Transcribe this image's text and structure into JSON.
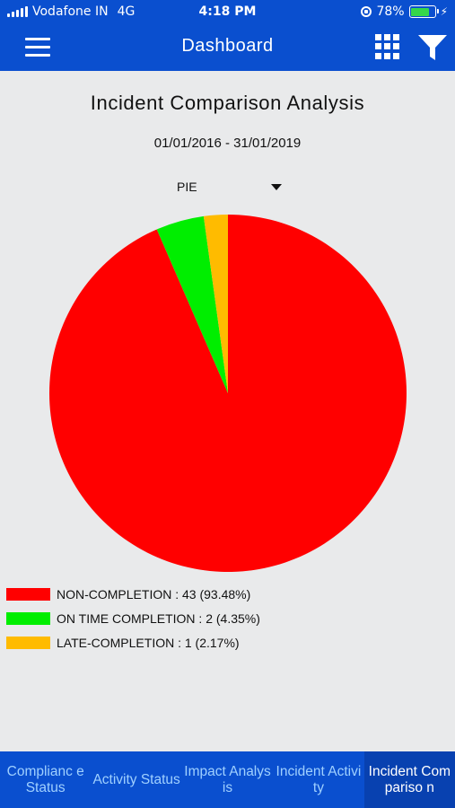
{
  "status_bar": {
    "carrier": "Vodafone IN",
    "network": "4G",
    "time": "4:18 PM",
    "battery": "78%",
    "battery_level": 0.78
  },
  "header": {
    "title": "Dashboard",
    "menu_icon": "hamburger-menu-icon",
    "grid_icon": "grid-icon",
    "filter_icon": "filter-icon",
    "color": "#0a4fcf"
  },
  "report": {
    "title": "Incident Comparison Analysis",
    "date_range": "01/01/2016 - 31/01/2019",
    "chart_type_selected": "PIE"
  },
  "chart_data": {
    "type": "pie",
    "slices": [
      {
        "label": "NON-COMPLETION",
        "value": 43,
        "percent": 93.48,
        "color": "#ff0000"
      },
      {
        "label": "ON TIME COMPLETION",
        "value": 2,
        "percent": 4.35,
        "color": "#00ee00"
      },
      {
        "label": "LATE-COMPLETION",
        "value": 1,
        "percent": 2.17,
        "color": "#ffbb00"
      }
    ],
    "legend_position": "bottom-left"
  },
  "legend": [
    {
      "text": "NON-COMPLETION : 43 (93.48%)",
      "color": "#ff0000"
    },
    {
      "text": "ON TIME COMPLETION : 2 (4.35%)",
      "color": "#00ee00"
    },
    {
      "text": "LATE-COMPLETION : 1 (2.17%)",
      "color": "#ffbb00"
    }
  ],
  "tabs": [
    {
      "label": "Complianc e Status",
      "active": false
    },
    {
      "label": "Activity Status",
      "active": false
    },
    {
      "label": "Impact Analysis",
      "active": false
    },
    {
      "label": "Incident Activity",
      "active": false
    },
    {
      "label": "Incident Compariso n",
      "active": true
    }
  ]
}
